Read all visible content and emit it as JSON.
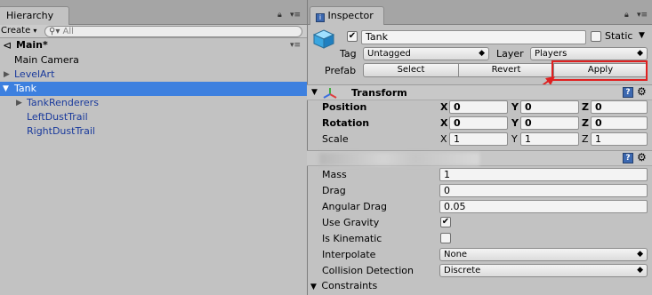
{
  "colors": {
    "selection": "#3d80df",
    "highlight_red": "#e02020",
    "child_text": "#1a3a9c"
  },
  "hierarchy": {
    "tab_label": "Hierarchy",
    "create_label": "Create",
    "search_placeholder": "All",
    "scene_name": "Main*",
    "items": [
      {
        "label": "Main Camera"
      },
      {
        "label": "LevelArt"
      },
      {
        "label": "Tank"
      },
      {
        "label": "TankRenderers"
      },
      {
        "label": "LeftDustTrail"
      },
      {
        "label": "RightDustTrail"
      }
    ]
  },
  "inspector": {
    "tab_label": "Inspector",
    "object_name": "Tank",
    "active_checked": true,
    "static_label": "Static",
    "static_checked": false,
    "tag_label": "Tag",
    "tag_value": "Untagged",
    "layer_label": "Layer",
    "layer_value": "Players",
    "prefab_label": "Prefab",
    "prefab_buttons": {
      "select": "Select",
      "revert": "Revert",
      "apply": "Apply"
    },
    "transform": {
      "title": "Transform",
      "position": {
        "label": "Position",
        "x": "0",
        "y": "0",
        "z": "0"
      },
      "rotation": {
        "label": "Rotation",
        "x": "0",
        "y": "0",
        "z": "0"
      },
      "scale": {
        "label": "Scale",
        "x": "1",
        "y": "1",
        "z": "1"
      },
      "axis_x": "X",
      "axis_y": "Y",
      "axis_z": "Z"
    },
    "rigidbody": {
      "mass_label": "Mass",
      "mass_value": "1",
      "drag_label": "Drag",
      "drag_value": "0",
      "angular_drag_label": "Angular Drag",
      "angular_drag_value": "0.05",
      "use_gravity_label": "Use Gravity",
      "use_gravity_checked": true,
      "is_kinematic_label": "Is Kinematic",
      "is_kinematic_checked": false,
      "interpolate_label": "Interpolate",
      "interpolate_value": "None",
      "collision_label": "Collision Detection",
      "collision_value": "Discrete",
      "constraints_label": "Constraints"
    }
  }
}
